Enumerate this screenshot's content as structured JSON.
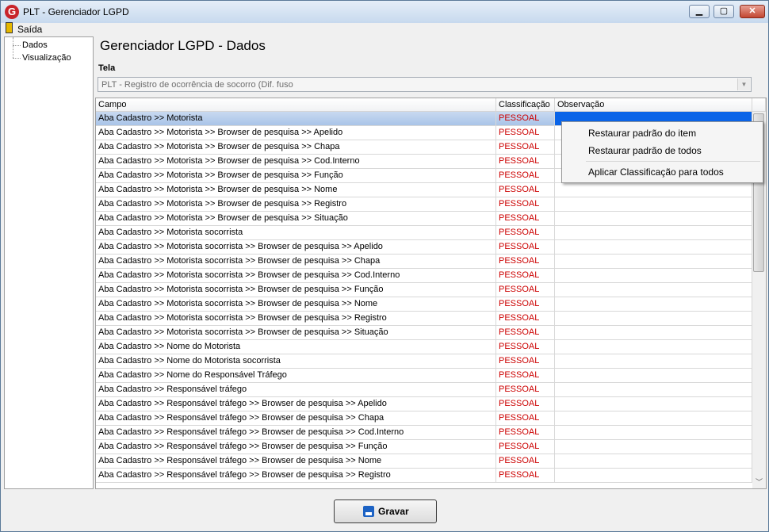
{
  "window": {
    "title": "PLT - Gerenciador LGPD",
    "app_icon_letter": "G"
  },
  "menu": {
    "exit_label": "Saída"
  },
  "tree": {
    "items": [
      "Dados",
      "Visualização"
    ]
  },
  "main": {
    "title": "Gerenciador LGPD - Dados",
    "screen_label": "Tela",
    "screen_value": "PLT - Registro de ocorrência de socorro (Dif. fuso"
  },
  "grid": {
    "headers": [
      "Campo",
      "Classificação",
      "Observação"
    ],
    "rows": [
      {
        "campo": "Aba Cadastro >> Motorista",
        "classificacao": "PESSOAL",
        "observacao": ""
      },
      {
        "campo": "Aba Cadastro >> Motorista >> Browser de pesquisa >> Apelido",
        "classificacao": "PESSOAL",
        "observacao": ""
      },
      {
        "campo": "Aba Cadastro >> Motorista >> Browser de pesquisa >> Chapa",
        "classificacao": "PESSOAL",
        "observacao": ""
      },
      {
        "campo": "Aba Cadastro >> Motorista >> Browser de pesquisa >> Cod.Interno",
        "classificacao": "PESSOAL",
        "observacao": ""
      },
      {
        "campo": "Aba Cadastro >> Motorista >> Browser de pesquisa >> Função",
        "classificacao": "PESSOAL",
        "observacao": ""
      },
      {
        "campo": "Aba Cadastro >> Motorista >> Browser de pesquisa >> Nome",
        "classificacao": "PESSOAL",
        "observacao": ""
      },
      {
        "campo": "Aba Cadastro >> Motorista >> Browser de pesquisa >> Registro",
        "classificacao": "PESSOAL",
        "observacao": ""
      },
      {
        "campo": "Aba Cadastro >> Motorista >> Browser de pesquisa >> Situação",
        "classificacao": "PESSOAL",
        "observacao": ""
      },
      {
        "campo": "Aba Cadastro >> Motorista socorrista",
        "classificacao": "PESSOAL",
        "observacao": ""
      },
      {
        "campo": "Aba Cadastro >> Motorista socorrista >> Browser de pesquisa >> Apelido",
        "classificacao": "PESSOAL",
        "observacao": ""
      },
      {
        "campo": "Aba Cadastro >> Motorista socorrista >> Browser de pesquisa >> Chapa",
        "classificacao": "PESSOAL",
        "observacao": ""
      },
      {
        "campo": "Aba Cadastro >> Motorista socorrista >> Browser de pesquisa >> Cod.Interno",
        "classificacao": "PESSOAL",
        "observacao": ""
      },
      {
        "campo": "Aba Cadastro >> Motorista socorrista >> Browser de pesquisa >> Função",
        "classificacao": "PESSOAL",
        "observacao": ""
      },
      {
        "campo": "Aba Cadastro >> Motorista socorrista >> Browser de pesquisa >> Nome",
        "classificacao": "PESSOAL",
        "observacao": ""
      },
      {
        "campo": "Aba Cadastro >> Motorista socorrista >> Browser de pesquisa >> Registro",
        "classificacao": "PESSOAL",
        "observacao": ""
      },
      {
        "campo": "Aba Cadastro >> Motorista socorrista >> Browser de pesquisa >> Situação",
        "classificacao": "PESSOAL",
        "observacao": ""
      },
      {
        "campo": "Aba Cadastro >> Nome do Motorista",
        "classificacao": "PESSOAL",
        "observacao": ""
      },
      {
        "campo": "Aba Cadastro >> Nome do Motorista socorrista",
        "classificacao": "PESSOAL",
        "observacao": ""
      },
      {
        "campo": "Aba Cadastro >> Nome do Responsável Tráfego",
        "classificacao": "PESSOAL",
        "observacao": ""
      },
      {
        "campo": "Aba Cadastro >> Responsável tráfego",
        "classificacao": "PESSOAL",
        "observacao": ""
      },
      {
        "campo": "Aba Cadastro >> Responsável tráfego >> Browser de pesquisa >> Apelido",
        "classificacao": "PESSOAL",
        "observacao": ""
      },
      {
        "campo": "Aba Cadastro >> Responsável tráfego >> Browser de pesquisa >> Chapa",
        "classificacao": "PESSOAL",
        "observacao": ""
      },
      {
        "campo": "Aba Cadastro >> Responsável tráfego >> Browser de pesquisa >> Cod.Interno",
        "classificacao": "PESSOAL",
        "observacao": ""
      },
      {
        "campo": "Aba Cadastro >> Responsável tráfego >> Browser de pesquisa >> Função",
        "classificacao": "PESSOAL",
        "observacao": ""
      },
      {
        "campo": "Aba Cadastro >> Responsável tráfego >> Browser de pesquisa >> Nome",
        "classificacao": "PESSOAL",
        "observacao": ""
      },
      {
        "campo": "Aba Cadastro >> Responsável tráfego >> Browser de pesquisa >> Registro",
        "classificacao": "PESSOAL",
        "observacao": ""
      }
    ]
  },
  "context_menu": {
    "items": [
      "Restaurar padrão do item",
      "Restaurar padrão de todos",
      "Aplicar Classificação para todos"
    ]
  },
  "footer": {
    "save_label": "Gravar"
  },
  "colors": {
    "classification_text": "#cc0000",
    "selection": "#0a64e8"
  },
  "icons": [
    "app-logo-icon",
    "exit-door-icon",
    "minimize-icon",
    "maximize-icon",
    "close-icon",
    "dropdown-arrow-icon",
    "floppy-disk-icon"
  ]
}
